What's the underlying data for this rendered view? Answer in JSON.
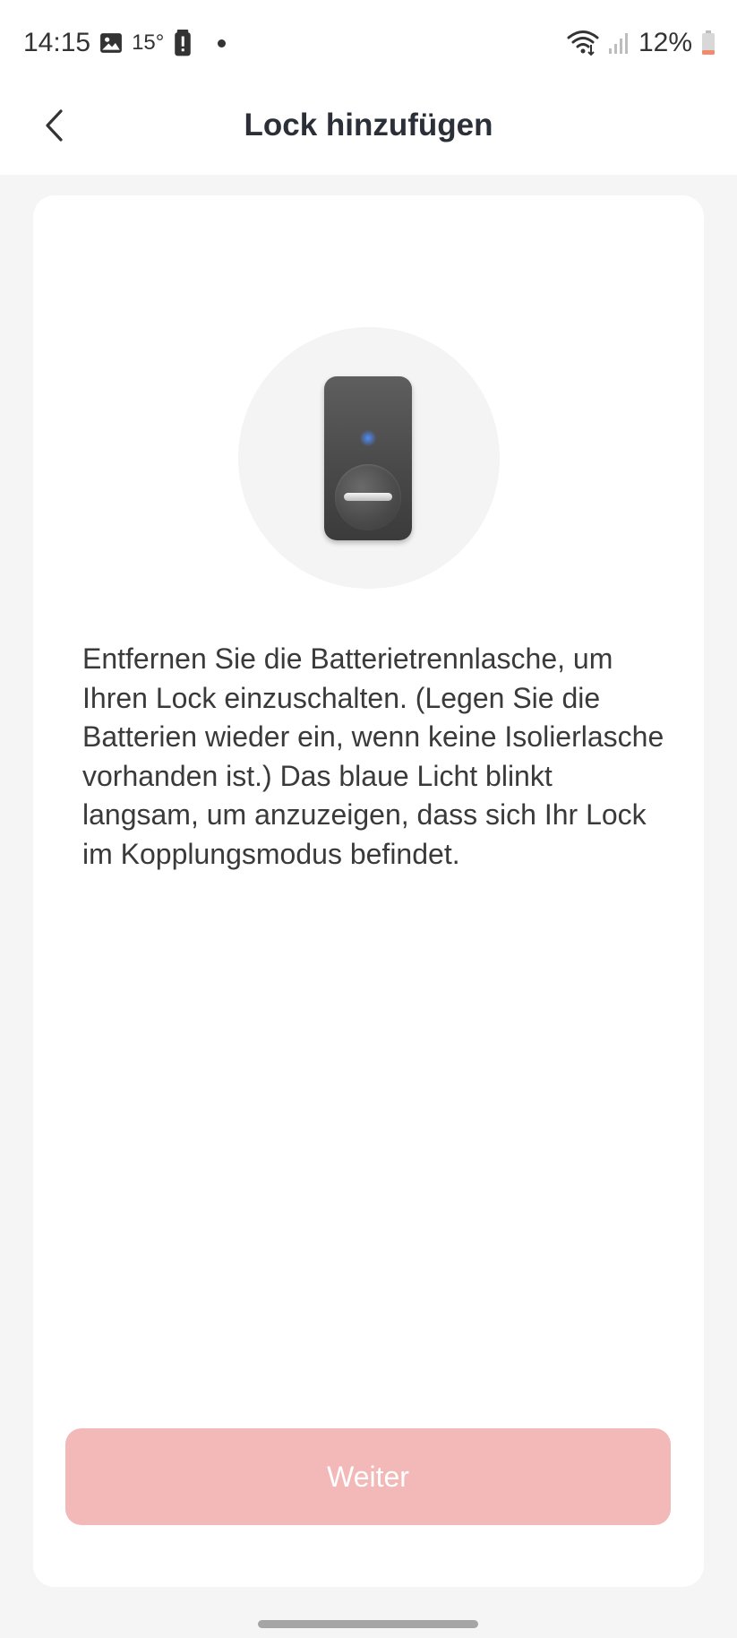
{
  "status_bar": {
    "time": "14:15",
    "temperature": "15°",
    "battery_percent": "12%",
    "icons": [
      "image-icon",
      "alert-icon",
      "wifi-icon",
      "signal-icon",
      "battery-icon"
    ]
  },
  "header": {
    "title": "Lock hinzufügen",
    "back_icon": "chevron-left-icon"
  },
  "main": {
    "illustration": "smart-lock-device",
    "instruction": "Entfernen Sie die Batterietrennlasche, um Ihren Lock einzuschalten. (Legen Sie die Batterien wieder ein, wenn keine Isolierlasche vorhanden ist.) Das blaue Licht blinkt langsam, um anzuzeigen, dass sich Ihr Lock im Kopplungsmodus befindet."
  },
  "footer": {
    "next_label": "Weiter"
  },
  "colors": {
    "accent_disabled": "#f3b8b8",
    "title_text": "#2b2f38",
    "background": "#f5f5f5",
    "led_blue": "#4d8cff"
  }
}
